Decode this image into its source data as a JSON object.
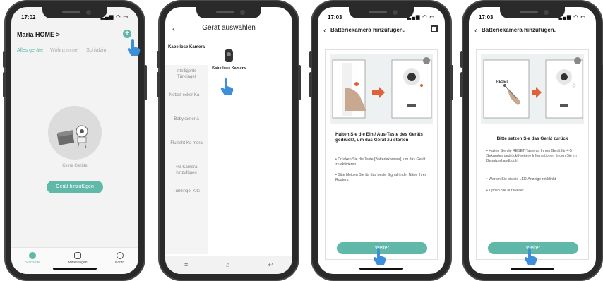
{
  "colors": {
    "accent": "#5fb8a8",
    "frame": "#2a2a2a"
  },
  "phone1": {
    "time": "17:02",
    "home_title": "Maria HOME >",
    "tabs": [
      "Alles geräte",
      "Wohnzimmer",
      "Schlafzim"
    ],
    "empty_text": "Keine Geräte",
    "add_device_button": "Gerät hinzufügen",
    "nav": [
      "Startseite",
      "Mitteilungen",
      "Konto"
    ]
  },
  "phone2": {
    "title": "Gerät auswählen",
    "categories": [
      "Kabellose Kamera",
      "Intelligente Türklingel",
      "Netzst ecker Ka···",
      "Babykamer a",
      "Flutlicht-Ka mera",
      "4G Kamera hinzufügen",
      "Türklingel-Kits"
    ],
    "selected_product": "Kabellose Kamera"
  },
  "phone3": {
    "time": "17:03",
    "title": "Batteriekamera hinzufügen.",
    "instruction_title": "Halten Sie die Ein / Aus-Taste des Geräts gedrückt, um das Gerät zu starten",
    "bullets": [
      "• Drücken Sie die Taste [Batteriekamera], um das Gerät zu aktivieren.",
      "• Bitte bleiben Sie für das beste Signal in der Nähe Ihres Routers."
    ],
    "next_button": "Weiter"
  },
  "phone4": {
    "time": "17:03",
    "title": "Batteriekamera hinzufügen.",
    "reset_label": "RESET",
    "instruction_title": "Bitte setzen Sie das Gerät zurück",
    "bullets": [
      "• Halten Sie die RESET-Taste an Ihrem Gerät für 4-5 Sekunden gedrückt(weitere Informationen finden Sie im Benutzerhandbuch)",
      "• Warten Sie bis die LED-Anzeige rot blinkt",
      "• Tippen Sie auf Weiter"
    ],
    "next_button": "Weiter"
  }
}
